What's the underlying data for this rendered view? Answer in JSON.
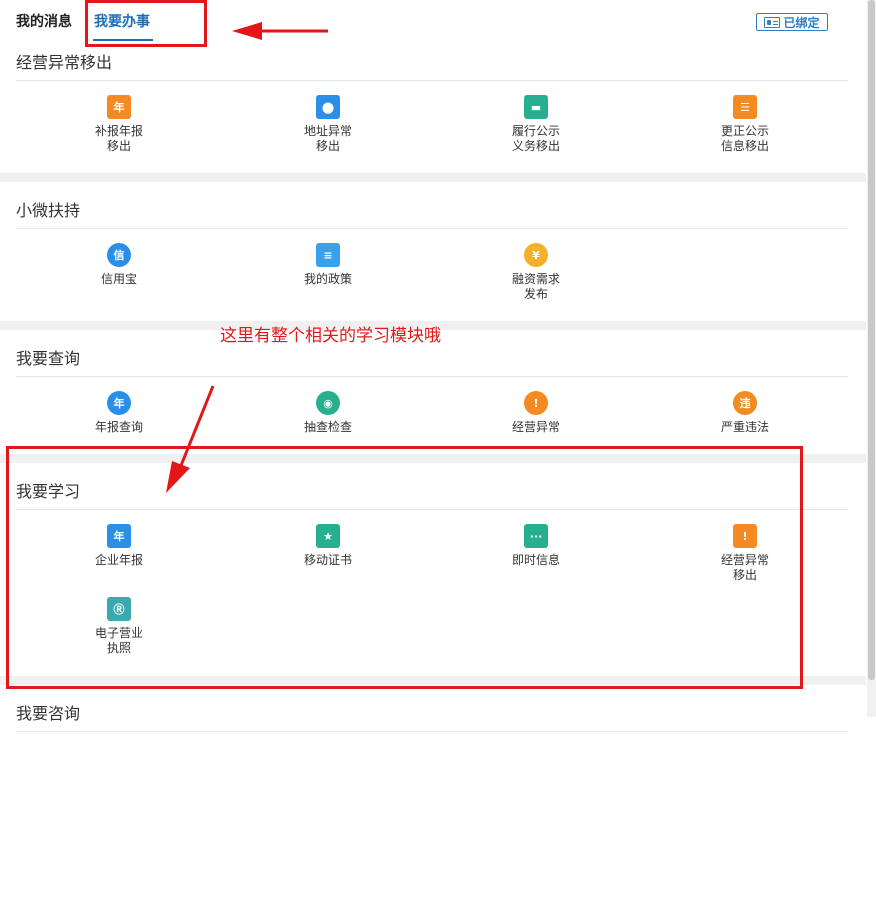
{
  "tabs": {
    "messages": "我的消息",
    "tasks": "我要办事"
  },
  "bound_badge": "已绑定",
  "annotation": {
    "text": "这里有整个相关的学习模块哦"
  },
  "colors": {
    "accent": "#1a6fb8",
    "annotation": "#e31717"
  },
  "sections": [
    {
      "title": "经营异常移出",
      "items": [
        {
          "label": "补报年报\n移出",
          "icon": "calendar-year-icon",
          "glyph": "年",
          "color": "#f38a23"
        },
        {
          "label": "地址异常\n移出",
          "icon": "location-pin-icon",
          "glyph": "⬤",
          "color": "#2b8ee8"
        },
        {
          "label": "履行公示\n义务移出",
          "icon": "briefcase-icon",
          "glyph": "▬",
          "color": "#27b08f"
        },
        {
          "label": "更正公示\n信息移出",
          "icon": "list-doc-icon",
          "glyph": "☰",
          "color": "#f38a23"
        }
      ]
    },
    {
      "title": "小微扶持",
      "items": [
        {
          "label": "信用宝",
          "icon": "credit-shield-icon",
          "glyph": "信",
          "color": "#2b8ee8"
        },
        {
          "label": "我的政策",
          "icon": "policy-document-icon",
          "glyph": "≡",
          "color": "#3aa0e8"
        },
        {
          "label": "融资需求\n发布",
          "icon": "money-bag-icon",
          "glyph": "¥",
          "color": "#f3b02a"
        }
      ]
    },
    {
      "title": "我要查询",
      "items": [
        {
          "label": "年报查询",
          "icon": "annual-report-query-icon",
          "glyph": "年",
          "color": "#2b8ee8"
        },
        {
          "label": "抽查检查",
          "icon": "inspection-search-icon",
          "glyph": "◉",
          "color": "#27b08f"
        },
        {
          "label": "经营异常",
          "icon": "exclamation-icon",
          "glyph": "!",
          "color": "#f38a23"
        },
        {
          "label": "严重违法",
          "icon": "violation-icon",
          "glyph": "违",
          "color": "#f38a23"
        }
      ]
    },
    {
      "title": "我要学习",
      "items": [
        {
          "label": "企业年报",
          "icon": "enterprise-annual-report-icon",
          "glyph": "年",
          "color": "#2b8ee8"
        },
        {
          "label": "移动证书",
          "icon": "mobile-certificate-icon",
          "glyph": "★",
          "color": "#27b08f"
        },
        {
          "label": "即时信息",
          "icon": "chat-bubble-icon",
          "glyph": "···",
          "color": "#27b08f"
        },
        {
          "label": "经营异常\n移出",
          "icon": "abnormal-removal-icon",
          "glyph": "!",
          "color": "#f38a23"
        },
        {
          "label": "电子营业\n执照",
          "icon": "business-license-icon",
          "glyph": "Ⓡ",
          "color": "#3aaab0"
        }
      ]
    },
    {
      "title": "我要咨询",
      "items": []
    }
  ]
}
